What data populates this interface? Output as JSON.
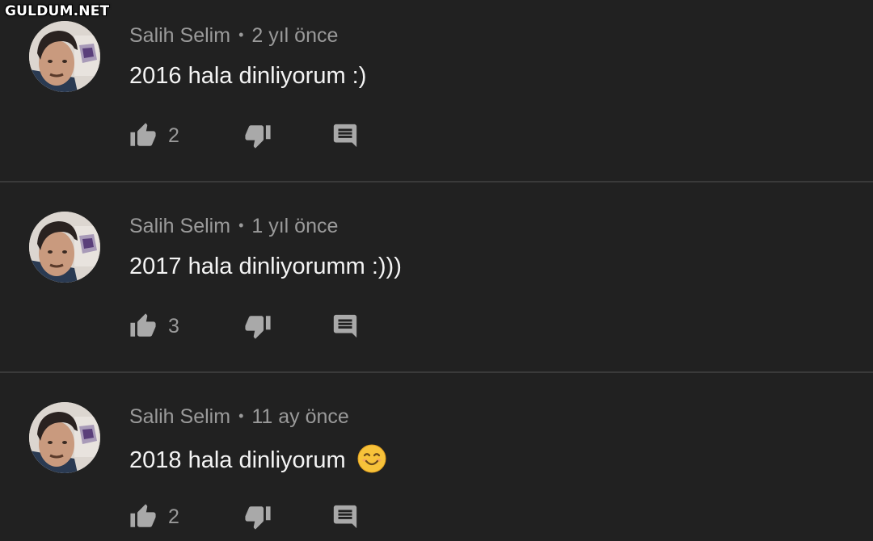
{
  "watermark": "GULDUM.NET",
  "comments": [
    {
      "author": "Salih Selim",
      "time": "2 yıl önce",
      "text": "2016 hala dinliyorum :)",
      "emoji": "",
      "likes": "2"
    },
    {
      "author": "Salih Selim",
      "time": "1 yıl önce",
      "text": "2017 hala dinliyorumm :)))",
      "emoji": "",
      "likes": "3"
    },
    {
      "author": "Salih Selim",
      "time": "11 ay önce",
      "text": "2018 hala dinliyorum",
      "emoji": "smiling-face-emoji",
      "likes": "2"
    }
  ],
  "icons": {
    "like": "thumbs-up-icon",
    "dislike": "thumbs-down-icon",
    "reply": "comment-reply-icon"
  },
  "colors": {
    "background": "#212121",
    "text_primary": "#f1f1f1",
    "text_secondary": "#9a9a9a",
    "icon": "#a9a9a9",
    "divider": "#3a3a3a"
  }
}
